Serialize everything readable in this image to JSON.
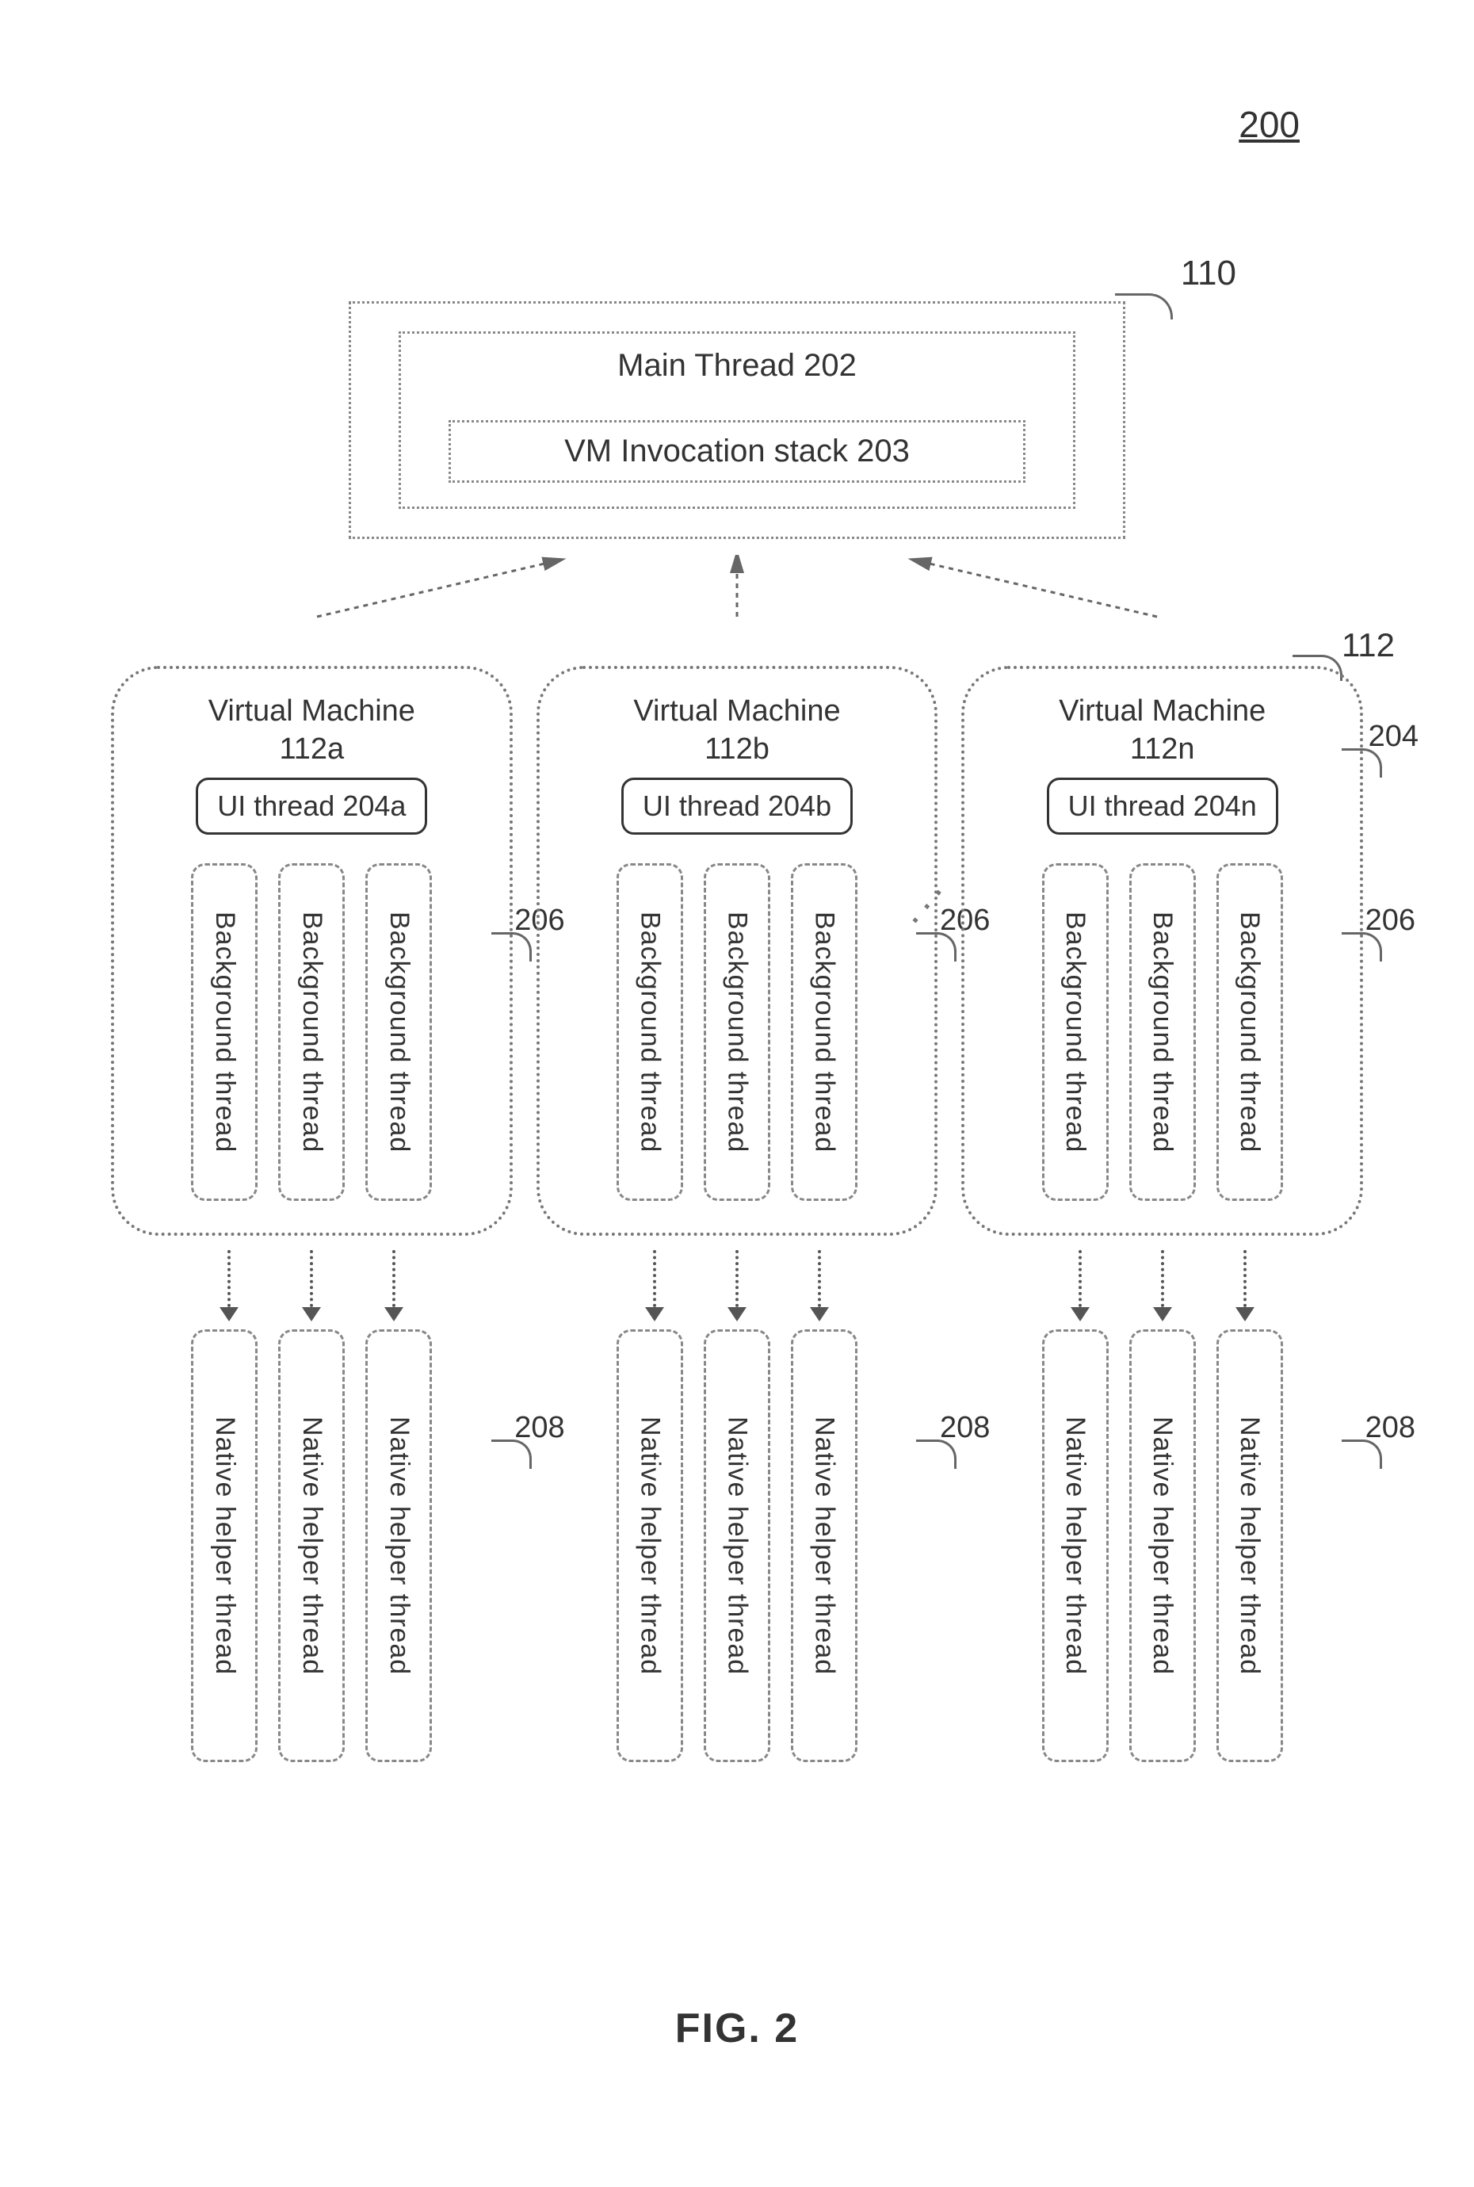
{
  "page_label": "200",
  "figure_label": "FIG. 2",
  "host": {
    "callout": "110",
    "main_thread_label": "Main Thread 202",
    "stack_label": "VM Invocation stack 203"
  },
  "group_callout": "112",
  "ui_thread_callout": "204",
  "vms": [
    {
      "title_line1": "Virtual Machine",
      "title_line2": "112a",
      "ui_thread": "UI thread 204a",
      "bg_callout": "206",
      "nh_callout": "208",
      "bg_label": "Background thread",
      "nh_label": "Native helper thread"
    },
    {
      "title_line1": "Virtual Machine",
      "title_line2": "112b",
      "ui_thread": "UI thread 204b",
      "bg_callout": "206",
      "nh_callout": "208",
      "bg_label": "Background thread",
      "nh_label": "Native helper thread"
    },
    {
      "title_line1": "Virtual Machine",
      "title_line2": "112n",
      "ui_thread": "UI thread 204n",
      "bg_callout": "206",
      "nh_callout": "208",
      "bg_label": "Background thread",
      "nh_label": "Native helper thread"
    }
  ],
  "ellipsis": "···"
}
